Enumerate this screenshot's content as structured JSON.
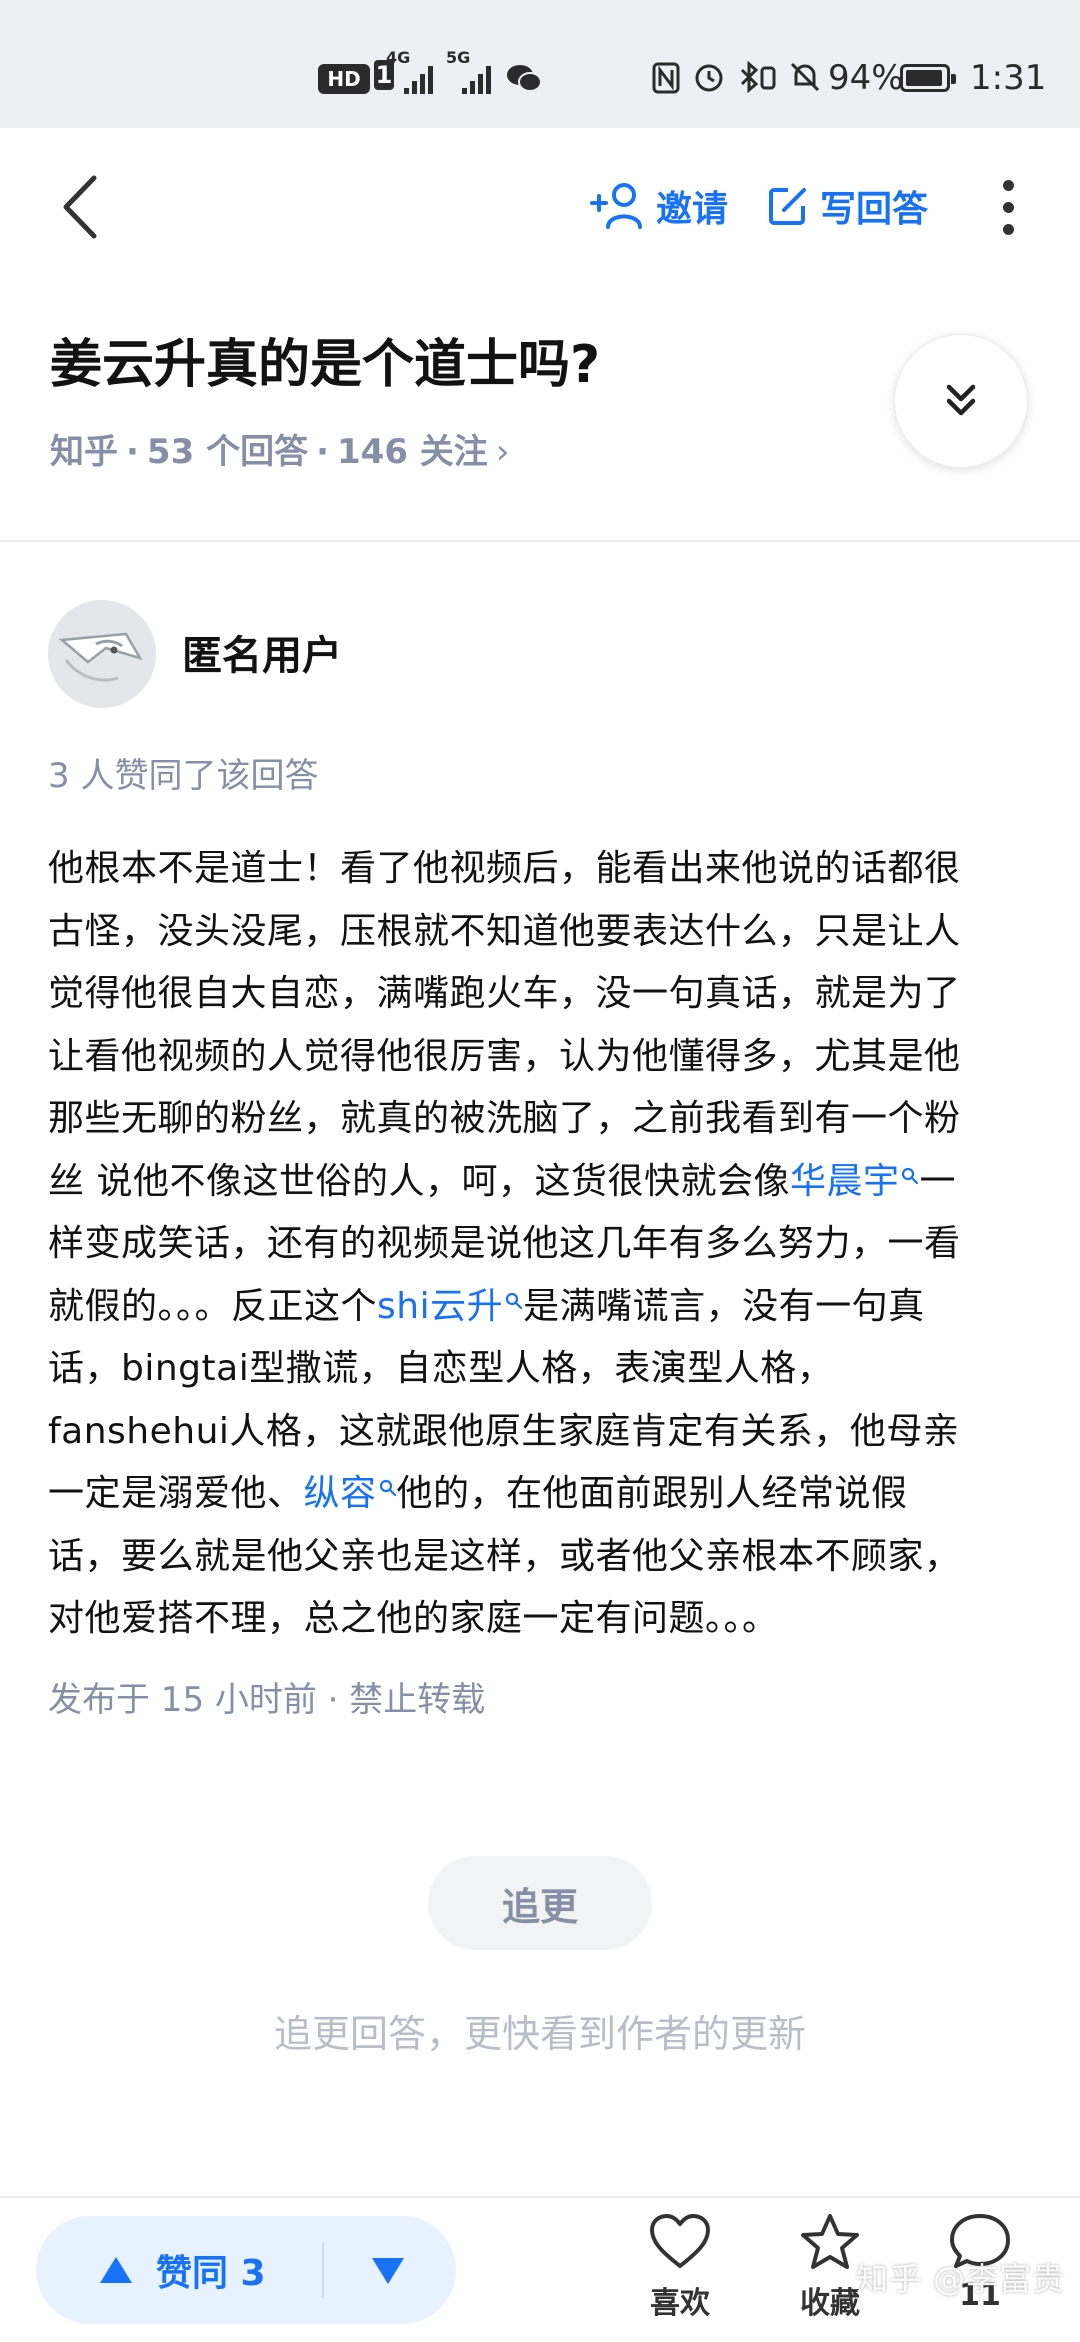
{
  "status_bar": {
    "hd_label": "HD",
    "sim_slot": "1",
    "net1": "4G",
    "net2": "5G",
    "battery_percent": "94%",
    "battery_level": 0.94,
    "time": "1:31",
    "icons": [
      "nfc-icon",
      "alarm-icon",
      "bluetooth-icon",
      "mute-icon",
      "wechat-icon"
    ]
  },
  "nav": {
    "invite_label": "邀请",
    "write_label": "写回答"
  },
  "question": {
    "title": "姜云升真的是个道士吗?",
    "meta_source": "知乎",
    "meta_answers": "53 个回答",
    "meta_follows": "146 关注",
    "separator": "·",
    "chevron": "›"
  },
  "answer": {
    "author": "匿名用户",
    "agree_line": "3 人赞同了该回答",
    "lines": [
      {
        "pre": "他根本不是道士！看了他视频后，能看出来他说的话都很",
        "kw": "",
        "post": ""
      },
      {
        "pre": "古怪，没头没尾，压根就不知道他要表达什么，只是让人",
        "kw": "",
        "post": ""
      },
      {
        "pre": "觉得他很自大自恋，满嘴跑火车，没一句真话，就是为了",
        "kw": "",
        "post": ""
      },
      {
        "pre": "让看他视频的人觉得他很厉害，认为他懂得多，尤其是他",
        "kw": "",
        "post": ""
      },
      {
        "pre": "那些无聊的粉丝，就真的被洗脑了，之前我看到有一个粉",
        "kw": "",
        "post": ""
      },
      {
        "pre": "丝 说他不像这世俗的人，呵，这货很快就会像",
        "kw": "华晨宇",
        "post": "一"
      },
      {
        "pre": "样变成笑话，还有的视频是说他这几年有多么努力，一看",
        "kw": "",
        "post": ""
      },
      {
        "pre": "就假的。。。反正这个",
        "kw": "shi云升",
        "post": "是满嘴谎言，没有一句真"
      },
      {
        "pre": "话，bingtai型撒谎，自恋型人格，表演型人格，",
        "kw": "",
        "post": ""
      },
      {
        "pre": "fanshehui人格，这就跟他原生家庭肯定有关系，他母亲",
        "kw": "",
        "post": ""
      },
      {
        "pre": "一定是溺爱他、",
        "kw": "纵容",
        "post": "他的，在他面前跟别人经常说假"
      },
      {
        "pre": "话，要么就是他父亲也是这样，或者他父亲根本不顾家，",
        "kw": "",
        "post": ""
      },
      {
        "pre": "对他爱搭不理，总之他的家庭一定有问题。。。",
        "kw": "",
        "post": ""
      }
    ],
    "published": "发布于 15 小时前 · 禁止转载"
  },
  "follow": {
    "button_label": "追更",
    "hint": "追更回答，更快看到作者的更新"
  },
  "bottom_bar": {
    "agree_label": "赞同 3",
    "like_label": "喜欢",
    "fav_label": "收藏",
    "comment_count": "11",
    "watermark": "知乎 @李富贵"
  },
  "colors": {
    "accent": "#1772f6",
    "meta_gray": "#8590a6",
    "status_bg": "#edeff2"
  }
}
